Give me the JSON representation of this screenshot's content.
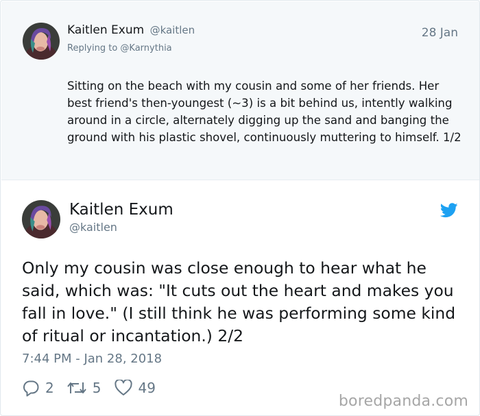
{
  "parent_tweet": {
    "author_name": "Kaitlen Exum",
    "author_handle": "@kaitlen",
    "date": "28 Jan",
    "replying_to": "Replying to @Karnythia",
    "text": "Sitting on the beach with my cousin and some of her friends. Her best friend's then-youngest (~3) is a bit behind us, intently walking around in a circle, alternately digging up the sand and banging the ground with his plastic shovel, continuously muttering to himself. 1/2"
  },
  "main_tweet": {
    "author_name": "Kaitlen Exum",
    "author_handle": "@kaitlen",
    "text": "Only my cousin was close enough to hear what he said, which was: \"It cuts out the heart and makes you fall in love.\" (I still think he was performing some kind of ritual or incantation.) 2/2",
    "timestamp": "7:44 PM - Jan 28, 2018",
    "replies": "2",
    "retweets": "5",
    "likes": "49"
  },
  "icons": {
    "brand": "twitter-bird-icon",
    "reply": "reply-bubble-icon",
    "retweet": "retweet-arrows-icon",
    "like": "heart-icon"
  },
  "colors": {
    "twitter_blue": "#1da1f2",
    "muted_text": "#657786",
    "parent_background": "#f5f8fa"
  },
  "watermark": "boredpanda.com"
}
